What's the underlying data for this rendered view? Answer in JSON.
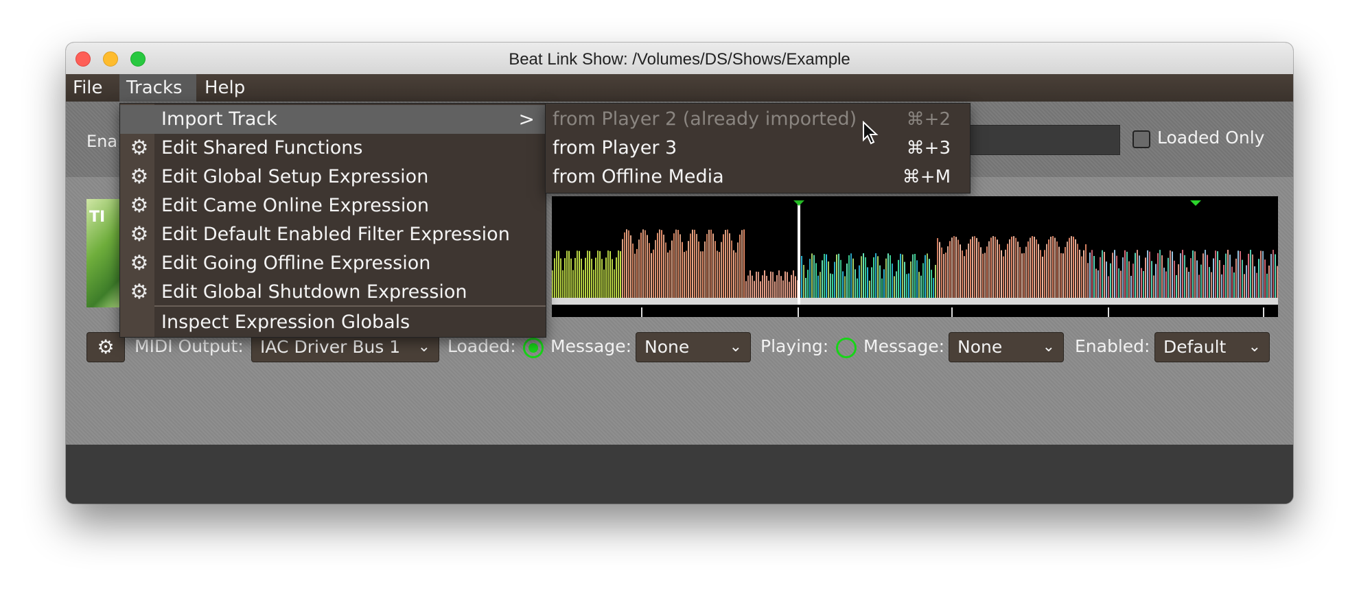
{
  "window": {
    "title": "Beat Link Show: /Volumes/DS/Shows/Example"
  },
  "menubar": {
    "items": [
      {
        "label": "File"
      },
      {
        "label": "Tracks"
      },
      {
        "label": "Help"
      }
    ]
  },
  "filter": {
    "enabled_label": "Ena",
    "loaded_only_label": "Loaded Only",
    "loaded_only_checked": false
  },
  "track_row": {
    "artwork_text": "TI",
    "midi_output_label": "MIDI Output:",
    "midi_output_value": "IAC Driver Bus 1",
    "loaded_label": "Loaded:",
    "loaded_message_label": "Message:",
    "loaded_message_value": "None",
    "playing_label": "Playing:",
    "playing_message_label": "Message:",
    "playing_message_value": "None",
    "enabled_label": "Enabled:",
    "enabled_value": "Default",
    "gear_icon": "gear-icon"
  },
  "tracks_menu": {
    "items": [
      {
        "label": "Import Track",
        "icon": "",
        "has_submenu": true,
        "highlighted": true
      },
      {
        "label": "Edit Shared Functions",
        "icon": "gear-icon"
      },
      {
        "label": "Edit Global Setup Expression",
        "icon": "gear-icon"
      },
      {
        "label": "Edit Came Online Expression",
        "icon": "gear-icon"
      },
      {
        "label": "Edit Default Enabled Filter Expression",
        "icon": "gear-icon"
      },
      {
        "label": "Edit Going Offline Expression",
        "icon": "gear-icon"
      },
      {
        "label": "Edit Global Shutdown Expression",
        "icon": "gear-icon"
      },
      {
        "label": "Inspect Expression Globals",
        "icon": ""
      }
    ],
    "submenu_arrow": ">"
  },
  "import_submenu": {
    "items": [
      {
        "label": "from Player 2 (already imported)",
        "shortcut": "⌘+2",
        "enabled": false
      },
      {
        "label": "from Player 3",
        "shortcut": "⌘+3",
        "enabled": true
      },
      {
        "label": "from Offline Media",
        "shortcut": "⌘+M",
        "enabled": true
      }
    ]
  },
  "colors": {
    "menubar_bg": "#3a322c",
    "menu_bg": "#3e3631",
    "content_bg": "#8f8f8f",
    "indicator_green": "#18d418"
  }
}
